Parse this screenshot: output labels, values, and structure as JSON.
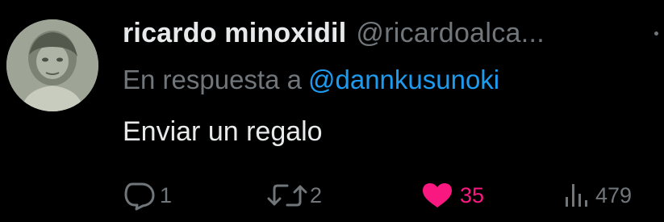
{
  "tweet": {
    "author": {
      "display_name": "ricardo minoxidil",
      "handle": "@ricardoalca..."
    },
    "reply_context": {
      "prefix": "En respuesta a",
      "mention": "@dannkusunoki"
    },
    "text": "Enviar un regalo",
    "stats": {
      "replies": "1",
      "retweets": "2",
      "likes": "35",
      "views": "479"
    }
  },
  "icons": {
    "reply": "reply-icon",
    "retweet": "retweet-icon",
    "like": "heart-icon",
    "views": "views-bar-chart-icon",
    "more": "more-icon"
  },
  "colors": {
    "background": "#000000",
    "primary_text": "#e7e9ea",
    "secondary_text": "#71767b",
    "mention": "#1d9bf0",
    "like_active": "#f91880"
  }
}
